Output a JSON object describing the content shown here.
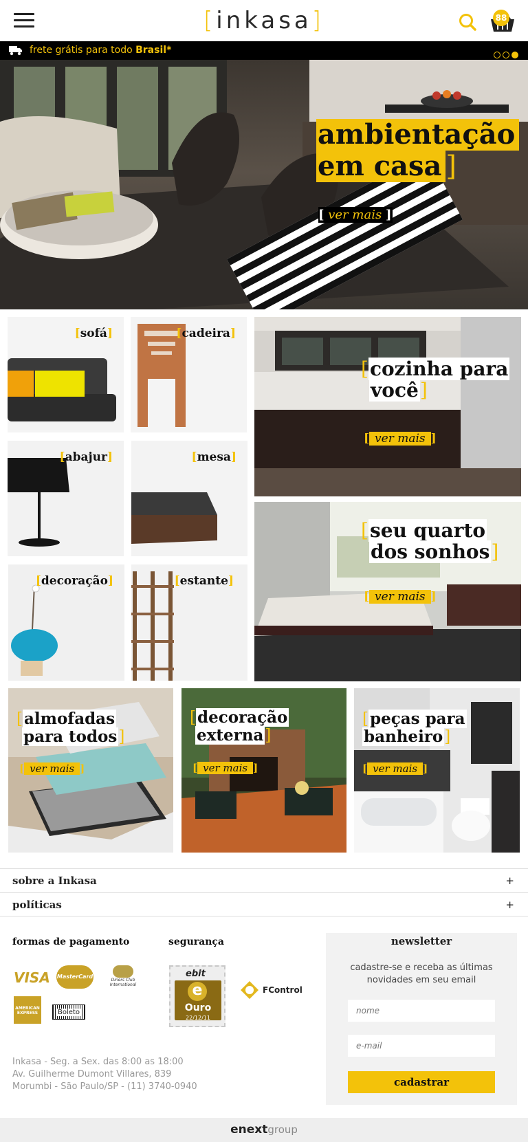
{
  "header": {
    "logo_text": "inkasa",
    "cart_count": "88",
    "accent_color": "#f3c20a"
  },
  "promo": {
    "text": "frete grátis para todo",
    "highlight": "Brasil*"
  },
  "hero": {
    "title_line1": "ambientação",
    "title_line2": "em casa",
    "cta": "ver mais"
  },
  "categories": {
    "sofa": "sofá",
    "cadeira": "cadeira",
    "abajur": "abajur",
    "mesa": "mesa",
    "decoracao": "decoração",
    "estante": "estante"
  },
  "promos": {
    "cozinha": {
      "line1": "cozinha para",
      "line2": "você",
      "cta": "ver mais"
    },
    "quarto": {
      "line1": "seu quarto",
      "line2": "dos sonhos",
      "cta": "ver mais"
    },
    "almofadas": {
      "line1": "almofadas",
      "line2": "para todos",
      "cta": "ver mais"
    },
    "externa": {
      "line1": "decoração",
      "line2": "externa",
      "cta": "ver mais"
    },
    "banheiro": {
      "line1": "peças para",
      "line2": "banheiro",
      "cta": "ver mais"
    }
  },
  "accordion": {
    "sobre": "sobre a Inkasa",
    "politicas": "políticas",
    "expand_symbol": "+"
  },
  "footer": {
    "pagamento_title": "formas de pagamento",
    "seguranca_title": "segurança",
    "payment_labels": {
      "visa": "VISA",
      "mastercard": "MasterCard",
      "diners": "Diners Club International",
      "amex": "AMERICAN EXPRESS",
      "boleto": "Boleto"
    },
    "ebit": {
      "brand": "ebit",
      "level": "Ouro",
      "date": "22/12/11"
    },
    "fcontrol": "FControl",
    "address_line1": "Inkasa - Seg. a Sex. das 8:00 as 18:00",
    "address_line2": "Av. Guilherme Dumont Villares, 839",
    "address_line3": "Morumbi - São Paulo/SP - (11) 3740-0940"
  },
  "newsletter": {
    "title": "newsletter",
    "description": "cadastre-se e receba as últimas novidades em seu email",
    "name_placeholder": "nome",
    "email_placeholder": "e-mail",
    "button": "cadastrar"
  },
  "credits": {
    "brand": "enext",
    "suffix": "group"
  }
}
